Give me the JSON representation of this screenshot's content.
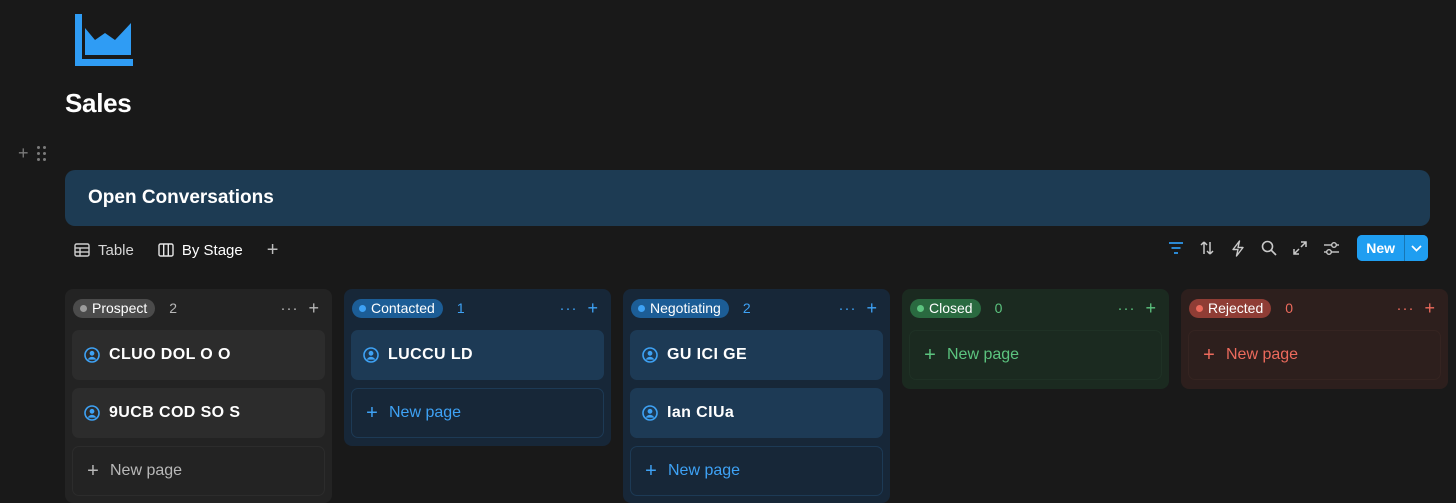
{
  "page": {
    "title": "Sales",
    "icon": "area-chart-icon",
    "accent": "#2f9cf4"
  },
  "callout": {
    "heading": "Open Conversations"
  },
  "views": {
    "tabs": [
      {
        "label": "Table",
        "icon": "table-icon"
      },
      {
        "label": "By Stage",
        "icon": "board-icon"
      }
    ],
    "add_icon": "plus-icon"
  },
  "toolbar": {
    "icons": [
      "filter-icon",
      "sort-icon",
      "automation-icon",
      "search-icon",
      "expand-icon",
      "settings-icon"
    ],
    "new_label": "New",
    "new_color": "#1f9ef1"
  },
  "board": {
    "new_page_label": "New page",
    "columns": [
      {
        "name": "Prospect",
        "count": "2",
        "colors": {
          "bg": "#232323",
          "card": "#2c2c2c",
          "pill": "#4b4b4b",
          "dot": "#9b9b9b",
          "text": "#b8b8b8"
        },
        "cards": [
          "CLUO DOL O O",
          "9UCB COD SO S"
        ]
      },
      {
        "name": "Contacted",
        "count": "1",
        "colors": {
          "bg": "#172738",
          "card": "#1d3a55",
          "pill": "#1c5d96",
          "dot": "#3ea2f5",
          "text": "#3ea2f5"
        },
        "cards": [
          "LUCCU LD"
        ]
      },
      {
        "name": "Negotiating",
        "count": "2",
        "colors": {
          "bg": "#172738",
          "card": "#1d3a55",
          "pill": "#1c5d96",
          "dot": "#3ea2f5",
          "text": "#3ea2f5"
        },
        "cards": [
          "GU ICI GE",
          "Ian CIUa"
        ]
      },
      {
        "name": "Closed",
        "count": "0",
        "colors": {
          "bg": "#1b2a20",
          "card": "#1f3125",
          "pill": "#2a6a40",
          "dot": "#5cc47f",
          "text": "#5cc47f"
        },
        "cards": []
      },
      {
        "name": "Rejected",
        "count": "0",
        "colors": {
          "bg": "#2d1f1d",
          "card": "#352421",
          "pill": "#8f3d35",
          "dot": "#ec6a5c",
          "text": "#ec6a5c"
        },
        "cards": []
      }
    ]
  }
}
